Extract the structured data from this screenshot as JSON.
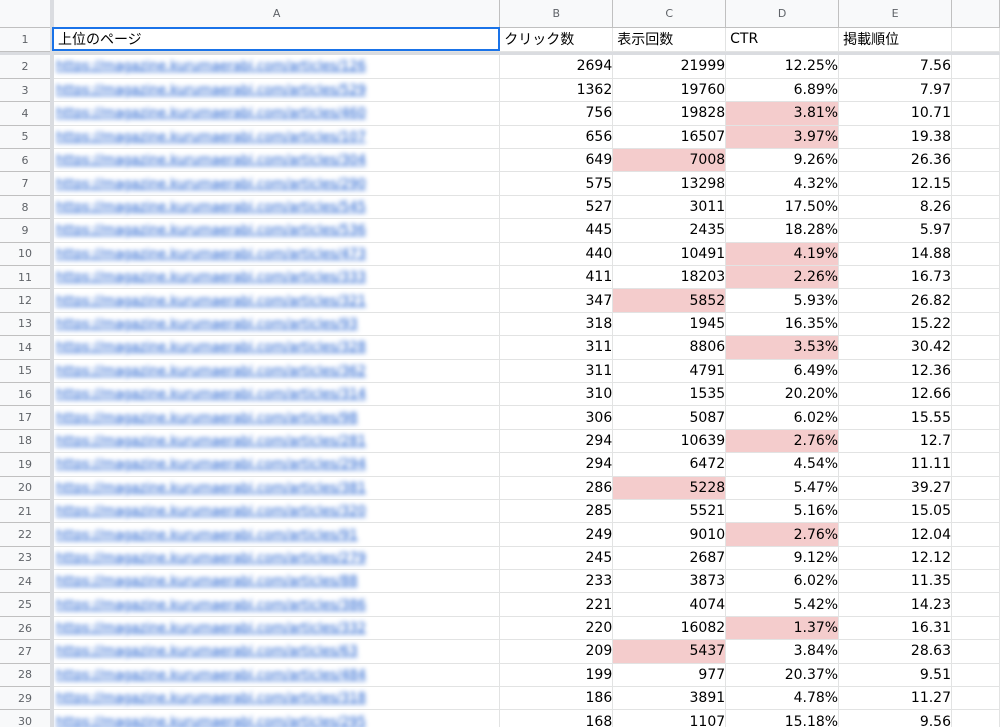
{
  "columns": [
    "A",
    "B",
    "C",
    "D",
    "E"
  ],
  "header_row_number": "1",
  "headers": [
    "上位のページ",
    "クリック数",
    "表示回数",
    "CTR",
    "掲載順位"
  ],
  "rows": [
    {
      "n": "2",
      "url": "https://magazine.kurumaerabi.com/articles/126",
      "clicks": "2694",
      "impressions": "21999",
      "ctr": "12.25%",
      "position": "7.56",
      "hl_imp": false,
      "hl_ctr": false
    },
    {
      "n": "3",
      "url": "https://magazine.kurumaerabi.com/articles/529",
      "clicks": "1362",
      "impressions": "19760",
      "ctr": "6.89%",
      "position": "7.97",
      "hl_imp": false,
      "hl_ctr": false
    },
    {
      "n": "4",
      "url": "https://magazine.kurumaerabi.com/articles/460",
      "clicks": "756",
      "impressions": "19828",
      "ctr": "3.81%",
      "position": "10.71",
      "hl_imp": false,
      "hl_ctr": true
    },
    {
      "n": "5",
      "url": "https://magazine.kurumaerabi.com/articles/107",
      "clicks": "656",
      "impressions": "16507",
      "ctr": "3.97%",
      "position": "19.38",
      "hl_imp": false,
      "hl_ctr": true
    },
    {
      "n": "6",
      "url": "https://magazine.kurumaerabi.com/articles/304",
      "clicks": "649",
      "impressions": "7008",
      "ctr": "9.26%",
      "position": "26.36",
      "hl_imp": true,
      "hl_ctr": false
    },
    {
      "n": "7",
      "url": "https://magazine.kurumaerabi.com/articles/290",
      "clicks": "575",
      "impressions": "13298",
      "ctr": "4.32%",
      "position": "12.15",
      "hl_imp": false,
      "hl_ctr": false
    },
    {
      "n": "8",
      "url": "https://magazine.kurumaerabi.com/articles/545",
      "clicks": "527",
      "impressions": "3011",
      "ctr": "17.50%",
      "position": "8.26",
      "hl_imp": false,
      "hl_ctr": false
    },
    {
      "n": "9",
      "url": "https://magazine.kurumaerabi.com/articles/536",
      "clicks": "445",
      "impressions": "2435",
      "ctr": "18.28%",
      "position": "5.97",
      "hl_imp": false,
      "hl_ctr": false
    },
    {
      "n": "10",
      "url": "https://magazine.kurumaerabi.com/articles/473",
      "clicks": "440",
      "impressions": "10491",
      "ctr": "4.19%",
      "position": "14.88",
      "hl_imp": false,
      "hl_ctr": true
    },
    {
      "n": "11",
      "url": "https://magazine.kurumaerabi.com/articles/333",
      "clicks": "411",
      "impressions": "18203",
      "ctr": "2.26%",
      "position": "16.73",
      "hl_imp": false,
      "hl_ctr": true
    },
    {
      "n": "12",
      "url": "https://magazine.kurumaerabi.com/articles/321",
      "clicks": "347",
      "impressions": "5852",
      "ctr": "5.93%",
      "position": "26.82",
      "hl_imp": true,
      "hl_ctr": false
    },
    {
      "n": "13",
      "url": "https://magazine.kurumaerabi.com/articles/93",
      "clicks": "318",
      "impressions": "1945",
      "ctr": "16.35%",
      "position": "15.22",
      "hl_imp": false,
      "hl_ctr": false
    },
    {
      "n": "14",
      "url": "https://magazine.kurumaerabi.com/articles/328",
      "clicks": "311",
      "impressions": "8806",
      "ctr": "3.53%",
      "position": "30.42",
      "hl_imp": false,
      "hl_ctr": true
    },
    {
      "n": "15",
      "url": "https://magazine.kurumaerabi.com/articles/362",
      "clicks": "311",
      "impressions": "4791",
      "ctr": "6.49%",
      "position": "12.36",
      "hl_imp": false,
      "hl_ctr": false
    },
    {
      "n": "16",
      "url": "https://magazine.kurumaerabi.com/articles/314",
      "clicks": "310",
      "impressions": "1535",
      "ctr": "20.20%",
      "position": "12.66",
      "hl_imp": false,
      "hl_ctr": false
    },
    {
      "n": "17",
      "url": "https://magazine.kurumaerabi.com/articles/98",
      "clicks": "306",
      "impressions": "5087",
      "ctr": "6.02%",
      "position": "15.55",
      "hl_imp": false,
      "hl_ctr": false
    },
    {
      "n": "18",
      "url": "https://magazine.kurumaerabi.com/articles/281",
      "clicks": "294",
      "impressions": "10639",
      "ctr": "2.76%",
      "position": "12.7",
      "hl_imp": false,
      "hl_ctr": true
    },
    {
      "n": "19",
      "url": "https://magazine.kurumaerabi.com/articles/294",
      "clicks": "294",
      "impressions": "6472",
      "ctr": "4.54%",
      "position": "11.11",
      "hl_imp": false,
      "hl_ctr": false
    },
    {
      "n": "20",
      "url": "https://magazine.kurumaerabi.com/articles/381",
      "clicks": "286",
      "impressions": "5228",
      "ctr": "5.47%",
      "position": "39.27",
      "hl_imp": true,
      "hl_ctr": false
    },
    {
      "n": "21",
      "url": "https://magazine.kurumaerabi.com/articles/320",
      "clicks": "285",
      "impressions": "5521",
      "ctr": "5.16%",
      "position": "15.05",
      "hl_imp": false,
      "hl_ctr": false
    },
    {
      "n": "22",
      "url": "https://magazine.kurumaerabi.com/articles/91",
      "clicks": "249",
      "impressions": "9010",
      "ctr": "2.76%",
      "position": "12.04",
      "hl_imp": false,
      "hl_ctr": true
    },
    {
      "n": "23",
      "url": "https://magazine.kurumaerabi.com/articles/279",
      "clicks": "245",
      "impressions": "2687",
      "ctr": "9.12%",
      "position": "12.12",
      "hl_imp": false,
      "hl_ctr": false
    },
    {
      "n": "24",
      "url": "https://magazine.kurumaerabi.com/articles/88",
      "clicks": "233",
      "impressions": "3873",
      "ctr": "6.02%",
      "position": "11.35",
      "hl_imp": false,
      "hl_ctr": false
    },
    {
      "n": "25",
      "url": "https://magazine.kurumaerabi.com/articles/386",
      "clicks": "221",
      "impressions": "4074",
      "ctr": "5.42%",
      "position": "14.23",
      "hl_imp": false,
      "hl_ctr": false
    },
    {
      "n": "26",
      "url": "https://magazine.kurumaerabi.com/articles/332",
      "clicks": "220",
      "impressions": "16082",
      "ctr": "1.37%",
      "position": "16.31",
      "hl_imp": false,
      "hl_ctr": true
    },
    {
      "n": "27",
      "url": "https://magazine.kurumaerabi.com/articles/63",
      "clicks": "209",
      "impressions": "5437",
      "ctr": "3.84%",
      "position": "28.63",
      "hl_imp": true,
      "hl_ctr": false
    },
    {
      "n": "28",
      "url": "https://magazine.kurumaerabi.com/articles/484",
      "clicks": "199",
      "impressions": "977",
      "ctr": "20.37%",
      "position": "9.51",
      "hl_imp": false,
      "hl_ctr": false
    },
    {
      "n": "29",
      "url": "https://magazine.kurumaerabi.com/articles/318",
      "clicks": "186",
      "impressions": "3891",
      "ctr": "4.78%",
      "position": "11.27",
      "hl_imp": false,
      "hl_ctr": false
    },
    {
      "n": "30",
      "url": "https://magazine.kurumaerabi.com/articles/295",
      "clicks": "168",
      "impressions": "1107",
      "ctr": "15.18%",
      "position": "9.56",
      "hl_imp": false,
      "hl_ctr": false
    }
  ],
  "colors": {
    "highlight": "#f4cccc",
    "link": "#1155cc",
    "selection": "#1a73e8"
  }
}
